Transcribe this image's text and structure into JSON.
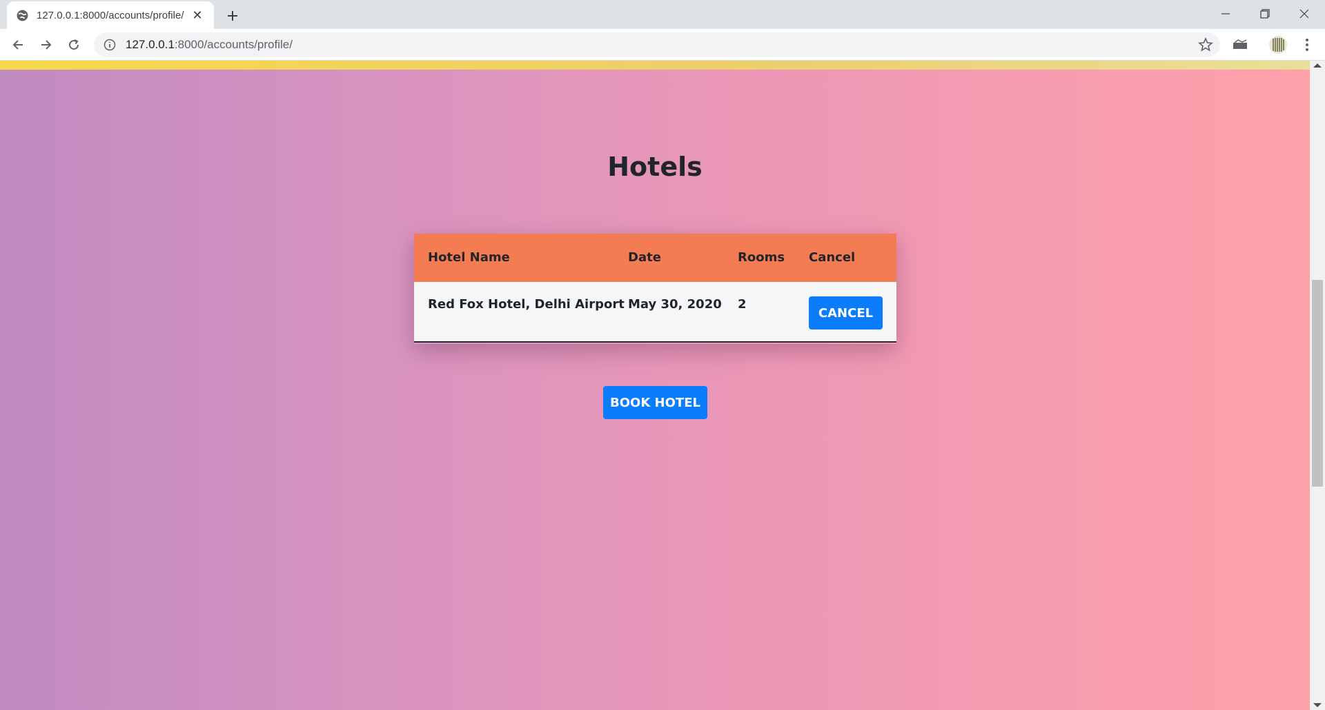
{
  "browser": {
    "tab_title": "127.0.0.1:8000/accounts/profile/",
    "url_host": "127.0.0.1",
    "url_path": ":8000/accounts/profile/"
  },
  "page": {
    "title": "Hotels",
    "table": {
      "headers": [
        "Hotel Name",
        "Date",
        "Rooms",
        "Cancel"
      ],
      "rows": [
        {
          "hotel_name": "Red Fox Hotel, Delhi Airport",
          "date": "May 30, 2020",
          "rooms": "2",
          "cancel_label": "CANCEL"
        }
      ]
    },
    "book_label": "BOOK HOTEL"
  },
  "colors": {
    "header": "#f47c53",
    "button": "#0b7dfa",
    "stripe": "#f7d84a"
  }
}
